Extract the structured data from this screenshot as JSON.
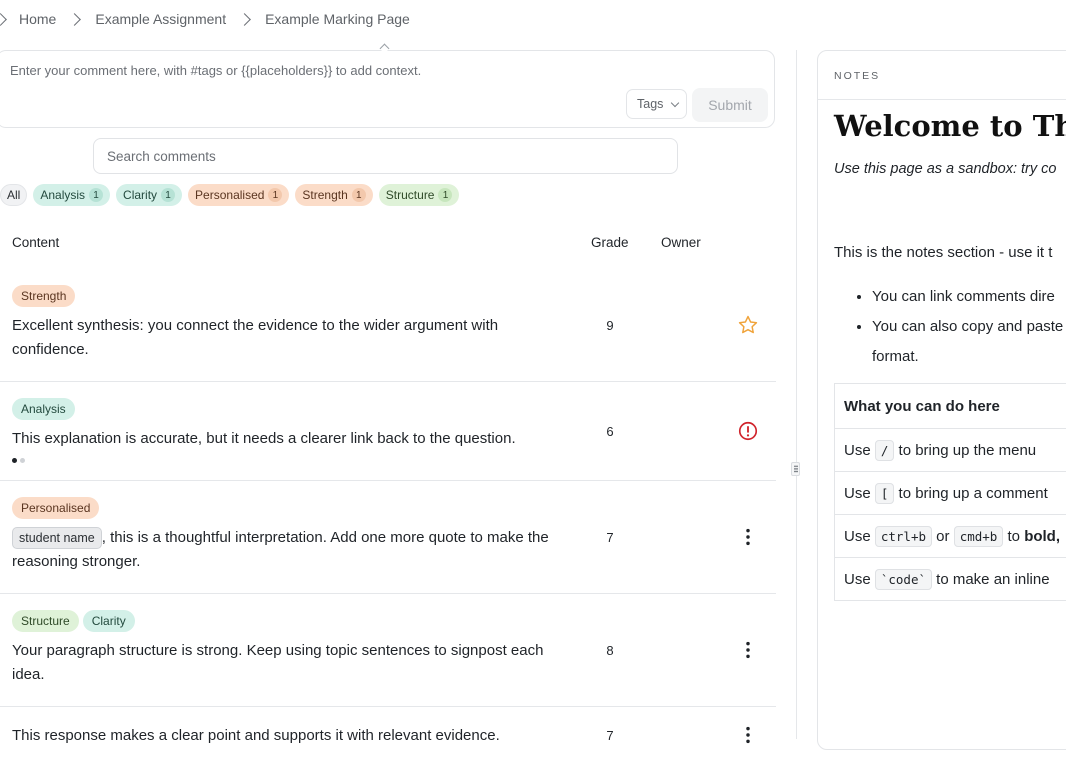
{
  "breadcrumb": [
    "Home",
    "Example Assignment",
    "Example Marking Page"
  ],
  "composer": {
    "placeholder": "Enter your comment here, with #tags or {{placeholders}} to add context.",
    "tags_label": "Tags",
    "submit_label": "Submit"
  },
  "search": {
    "placeholder": "Search comments"
  },
  "filters": {
    "all_label": "All",
    "items": [
      {
        "label": "Analysis",
        "count": "1"
      },
      {
        "label": "Clarity",
        "count": "1"
      },
      {
        "label": "Personalised",
        "count": "1"
      },
      {
        "label": "Strength",
        "count": "1"
      },
      {
        "label": "Structure",
        "count": "1"
      }
    ]
  },
  "table": {
    "headers": {
      "content": "Content",
      "grade": "Grade",
      "owner": "Owner"
    },
    "rows": [
      {
        "tags": [
          "Strength"
        ],
        "text": "Excellent synthesis: you connect the evidence to the wider argument with confidence.",
        "grade": "9",
        "action": "star-icon"
      },
      {
        "tags": [
          "Analysis"
        ],
        "text": "This explanation is accurate, but it needs a clearer link back to the question.",
        "grade": "6",
        "action": "alert-icon",
        "pager_dots": 2
      },
      {
        "tags": [
          "Personalised"
        ],
        "placeholder": "student name",
        "text": ", this is a thoughtful interpretation. Add one more quote to make the reasoning stronger.",
        "grade": "7",
        "action": "more-icon"
      },
      {
        "tags": [
          "Structure",
          "Clarity"
        ],
        "text": "Your paragraph structure is strong. Keep using topic sentences to signpost each idea.",
        "grade": "8",
        "action": "more-icon"
      },
      {
        "tags": [],
        "text": "This response makes a clear point and supports it with relevant evidence.",
        "grade": "7",
        "action": "more-icon"
      }
    ]
  },
  "notes": {
    "label": "NOTES",
    "title": "Welcome to The",
    "subtitle": "Use this page as a sandbox: try co",
    "paragraph": "This is the notes section - use it t",
    "bullets": [
      "You can link comments dire",
      "You can also copy and paste",
      "format."
    ],
    "table": {
      "header": "What you can do here",
      "rows": [
        {
          "pre": "Use ",
          "codes": [
            "/"
          ],
          "post": " to bring up the menu"
        },
        {
          "pre": "Use ",
          "codes": [
            "["
          ],
          "post": " to bring up a comment"
        },
        {
          "pre": "Use ",
          "codes": [
            "ctrl+b",
            "cmd+b"
          ],
          "joiner": " or ",
          "post": " to ",
          "bold": "bold,"
        },
        {
          "pre": "Use ",
          "codes": [
            "`code`"
          ],
          "post": " to make an inline"
        }
      ]
    }
  },
  "colors": {
    "tag_green": "#d3f0e8",
    "tag_orange": "#fbdcc8",
    "tag_lime": "#dff2d8",
    "star": "#f0a33a",
    "alert": "#d0232b"
  }
}
